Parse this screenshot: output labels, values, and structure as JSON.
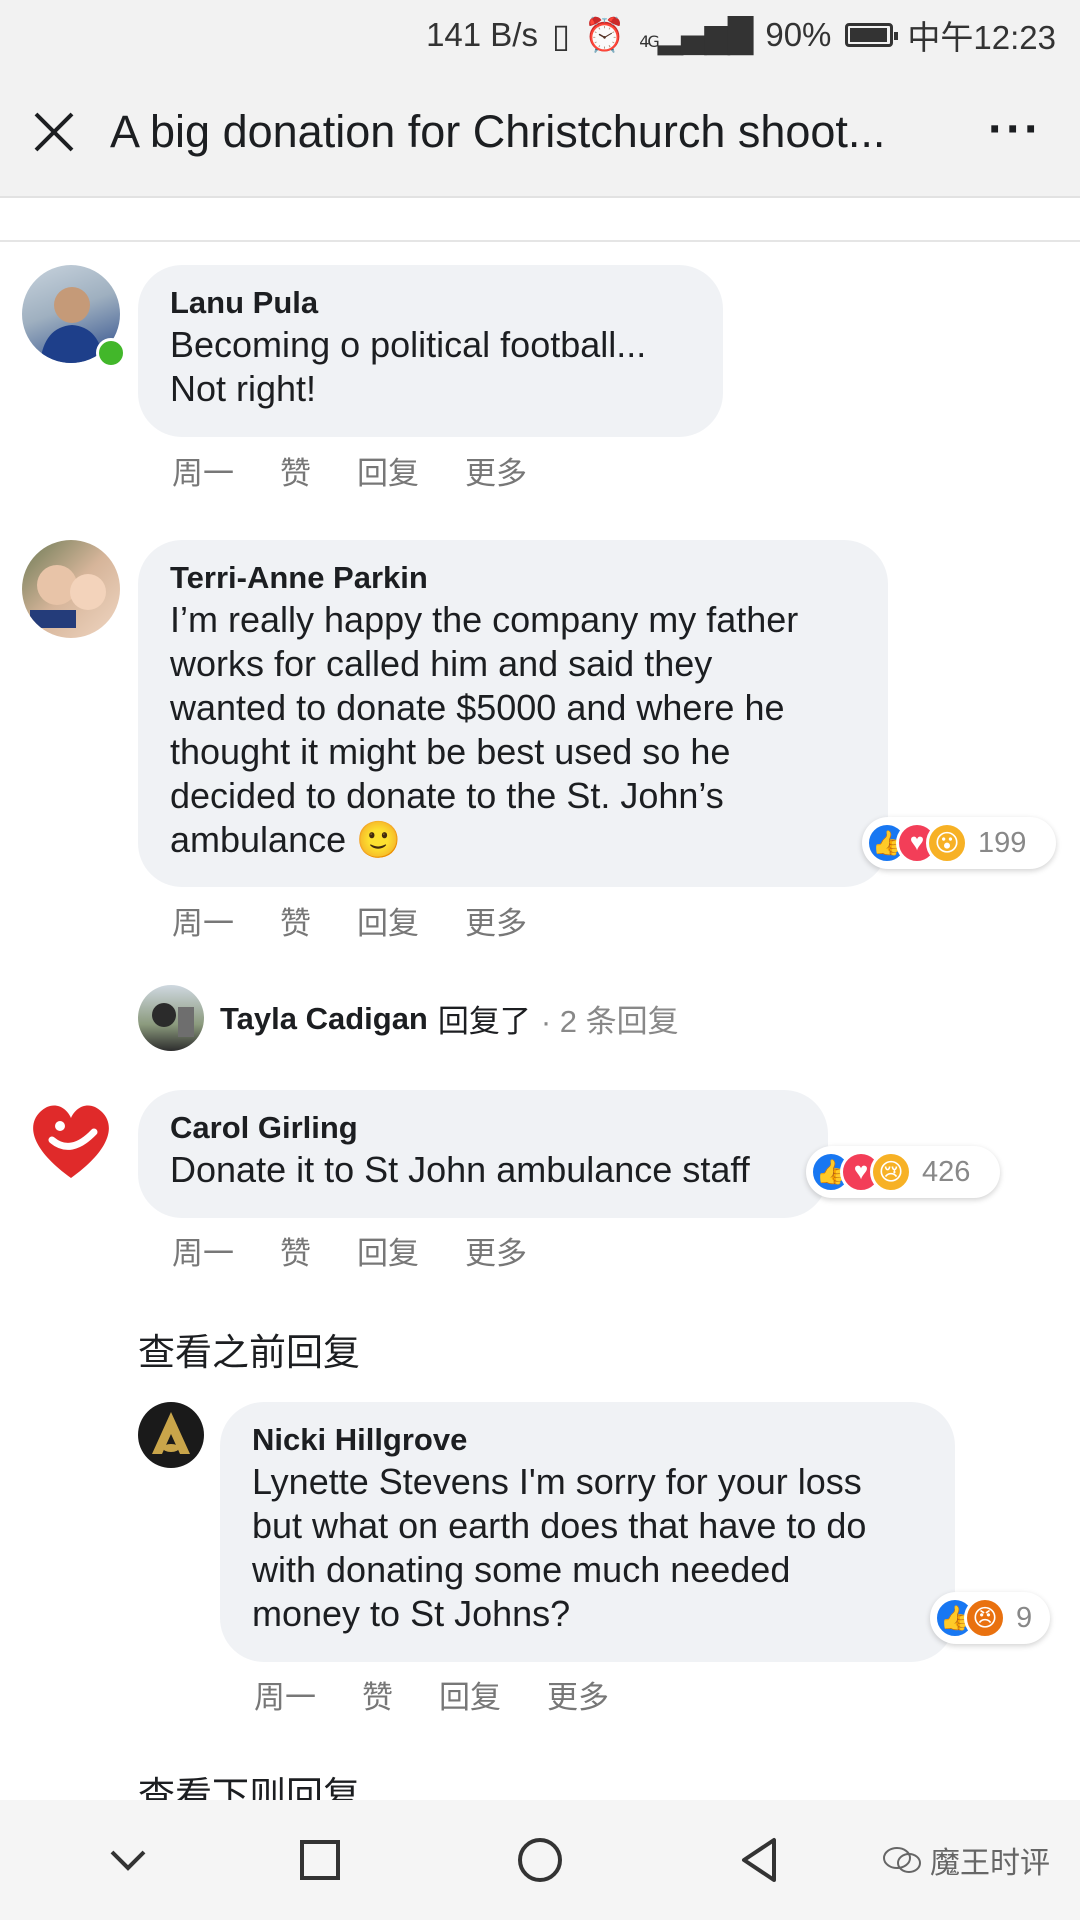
{
  "status_bar": {
    "speed": "141 B/s",
    "network": "4G",
    "battery": "90%",
    "time": "中午12:23"
  },
  "header": {
    "title": "A big donation for Christchurch shoot..."
  },
  "comments": [
    {
      "author": "Lanu Pula",
      "text_lines": [
        "Becoming o political football...",
        "Not right!"
      ],
      "time": "周一",
      "like": "赞",
      "reply": "回复",
      "more": "更多"
    },
    {
      "author": "Terri-Anne Parkin",
      "text_lines": [
        "I’m really happy the company my father",
        "works for called him and said they",
        "wanted to donate $5000 and where he",
        "thought it might be best used so he",
        "decided to donate to the St. John’s",
        "ambulance 🙂"
      ],
      "reactions_count": "199",
      "time": "周一",
      "like": "赞",
      "reply": "回复",
      "more": "更多"
    },
    {
      "author": "Carol Girling",
      "text_lines": [
        "Donate it to St John ambulance staff"
      ],
      "reactions_count": "426",
      "time": "周一",
      "like": "赞",
      "reply": "回复",
      "more": "更多"
    }
  ],
  "reply_summary": {
    "name": "Tayla Cadigan",
    "replied": "回复了",
    "count": "· 2 条回复"
  },
  "view_previous": "查看之前回复",
  "nested_reply": {
    "author": "Nicki Hillgrove",
    "text_lines": [
      "Lynette Stevens I'm sorry for your loss",
      "but what on earth does that have to do",
      "with donating some much needed",
      "money to St Johns?"
    ],
    "reactions_count": "9",
    "time": "周一",
    "like": "赞",
    "reply": "回复",
    "more": "更多"
  },
  "view_next": "查看下则回复",
  "watermark": "魔王时评",
  "colors": {
    "like": "#1877f2",
    "love": "#f33e58",
    "wow": "#f7b125",
    "angry": "#e9710f",
    "online": "#42b72a",
    "bubble": "#f0f2f5"
  }
}
